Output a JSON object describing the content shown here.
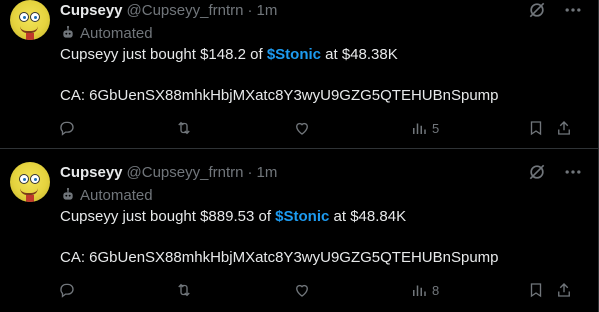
{
  "tweets": [
    {
      "author": {
        "name": "Cupseyy",
        "handle": "@Cupseyy_frntrn",
        "separator": "·",
        "time": "1m"
      },
      "automated_label": "Automated",
      "text": {
        "prefix": "Cupseyy just bought $148.2 of ",
        "cashtag": "$Stonic",
        "suffix": " at $48.38K"
      },
      "ca_line": "CA: 6GbUenSX88mhkHbjMXatc8Y3wyU9GZG5QTEHUBnSpump",
      "actions": {
        "views": "5"
      }
    },
    {
      "author": {
        "name": "Cupseyy",
        "handle": "@Cupseyy_frntrn",
        "separator": "·",
        "time": "1m"
      },
      "automated_label": "Automated",
      "text": {
        "prefix": "Cupseyy just bought $889.53 of ",
        "cashtag": "$Stonic",
        "suffix": " at $48.84K"
      },
      "ca_line": "CA: 6GbUenSX88mhkHbjMXatc8Y3wyU9GZG5QTEHUBnSpump",
      "actions": {
        "views": "8"
      }
    }
  ],
  "icons": {
    "reply": "reply-icon",
    "retweet": "retweet-icon",
    "like": "like-icon",
    "views": "views-icon",
    "bookmark": "bookmark-icon",
    "share": "share-icon",
    "grok": "grok-icon",
    "more": "more-icon",
    "bot": "bot-icon"
  },
  "colors": {
    "background": "#000000",
    "text": "#e7e9ea",
    "muted": "#71767b",
    "accent": "#1d9bf0",
    "border": "#2f3336"
  }
}
